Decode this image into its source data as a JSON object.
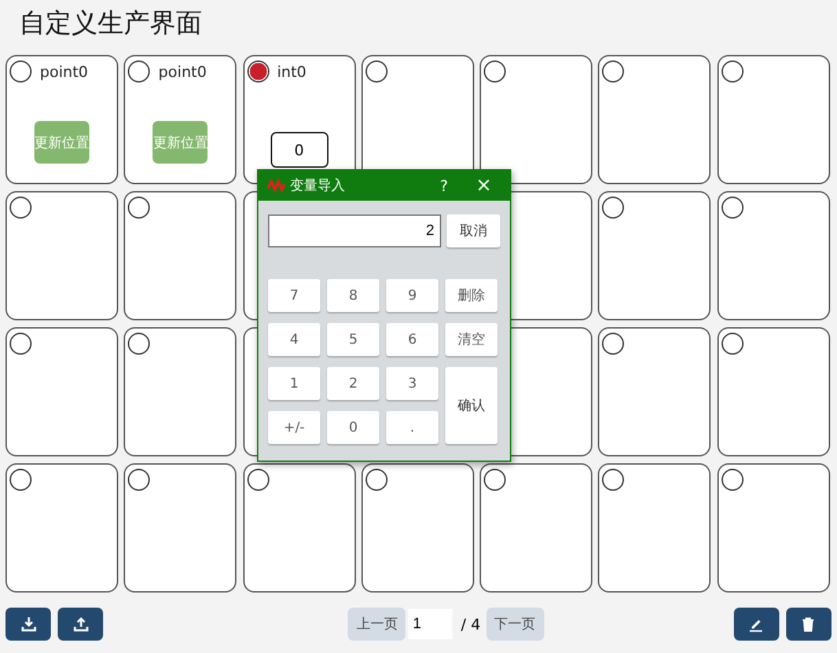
{
  "title": "自定义生产界面",
  "cells": [
    {
      "kind": "point",
      "label": "point0",
      "selected": false,
      "button": "更新位置"
    },
    {
      "kind": "point",
      "label": "point0",
      "selected": false,
      "button": "更新位置"
    },
    {
      "kind": "int",
      "label": "int0",
      "selected": true,
      "value": "0"
    },
    {
      "kind": "empty",
      "selected": false
    },
    {
      "kind": "empty",
      "selected": false
    },
    {
      "kind": "empty",
      "selected": false
    },
    {
      "kind": "empty",
      "selected": false
    },
    {
      "kind": "empty",
      "selected": false
    },
    {
      "kind": "empty",
      "selected": false
    },
    {
      "kind": "empty"
    },
    {
      "kind": "covered"
    },
    {
      "kind": "empty"
    },
    {
      "kind": "empty",
      "selected": false
    },
    {
      "kind": "empty",
      "selected": false
    },
    {
      "kind": "empty",
      "selected": false
    },
    {
      "kind": "empty",
      "selected": false
    },
    {
      "kind": "empty"
    },
    {
      "kind": "covered"
    },
    {
      "kind": "empty"
    },
    {
      "kind": "empty",
      "selected": false
    },
    {
      "kind": "empty",
      "selected": false
    },
    {
      "kind": "empty",
      "selected": false
    },
    {
      "kind": "empty",
      "selected": false
    },
    {
      "kind": "empty",
      "selected": false
    },
    {
      "kind": "empty",
      "selected": false
    },
    {
      "kind": "empty",
      "selected": false
    },
    {
      "kind": "empty",
      "selected": false
    },
    {
      "kind": "empty",
      "selected": false
    }
  ],
  "dialog": {
    "title": "变量导入",
    "help": "?",
    "close": "×",
    "value": "2",
    "cancel": "取消",
    "keys": [
      {
        "label": "7",
        "kind": "key"
      },
      {
        "label": "8",
        "kind": "key"
      },
      {
        "label": "9",
        "kind": "key"
      },
      {
        "label": "删除",
        "kind": "key"
      },
      {
        "label": "4",
        "kind": "key"
      },
      {
        "label": "5",
        "kind": "key"
      },
      {
        "label": "6",
        "kind": "key"
      },
      {
        "label": "清空",
        "kind": "key"
      },
      {
        "label": "1",
        "kind": "key"
      },
      {
        "label": "2",
        "kind": "key"
      },
      {
        "label": "3",
        "kind": "key"
      },
      {
        "label": "确认",
        "kind": "tall"
      },
      {
        "label": "+/-",
        "kind": "key"
      },
      {
        "label": "0",
        "kind": "key"
      },
      {
        "label": ".",
        "kind": "key"
      }
    ]
  },
  "pager": {
    "prev": "上一页",
    "page": "1",
    "total": "/ 4",
    "next": "下一页"
  }
}
